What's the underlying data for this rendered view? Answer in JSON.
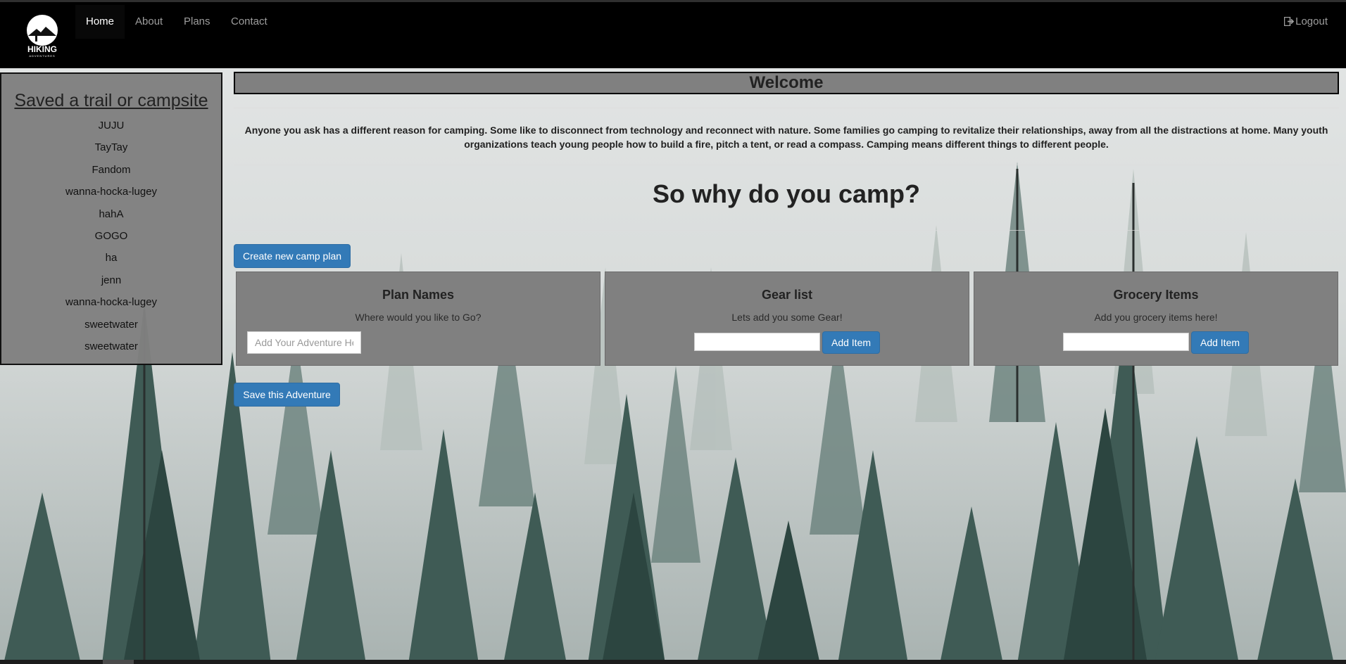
{
  "brand": {
    "logo_text": "HIKING",
    "logo_subtext": "ADVENTURES"
  },
  "nav": {
    "items": [
      {
        "label": "Home",
        "active": true
      },
      {
        "label": "About",
        "active": false
      },
      {
        "label": "Plans",
        "active": false
      },
      {
        "label": "Contact",
        "active": false
      }
    ],
    "logout_label": "Logout",
    "logout_icon": "logout-icon"
  },
  "sidebar": {
    "title": "Saved a trail or campsite",
    "items": [
      "JUJU",
      "TayTay",
      "Fandom",
      "wanna-hocka-lugey",
      "hahA",
      "GOGO",
      "ha",
      "jenn",
      "wanna-hocka-lugey",
      "sweetwater",
      "sweetwater"
    ]
  },
  "main": {
    "welcome": "Welcome",
    "intro": "Anyone you ask has a different reason for camping. Some like to disconnect from technology and reconnect with nature. Some families go camping to revitalize their relationships, away from all the distractions at home. Many youth organizations teach young people how to build a fire, pitch a tent, or read a compass. Camping means different things to different people.",
    "question": "So why do you camp?",
    "create_button": "Create new camp plan",
    "save_button": "Save this Adventure",
    "panels": {
      "plan": {
        "title": "Plan Names",
        "subtitle": "Where would you like to Go?",
        "placeholder": "Add Your Adventure Here"
      },
      "gear": {
        "title": "Gear list",
        "subtitle": "Lets add you some Gear!",
        "value": "",
        "button": "Add Item"
      },
      "grocery": {
        "title": "Grocery Items",
        "subtitle": "Add you grocery items here!",
        "value": "",
        "button": "Add Item"
      }
    }
  },
  "colors": {
    "navbar": "#000000",
    "primary_button": "#337ab7",
    "panel_bg": "#808080",
    "sidebar_bg": "#808080"
  }
}
